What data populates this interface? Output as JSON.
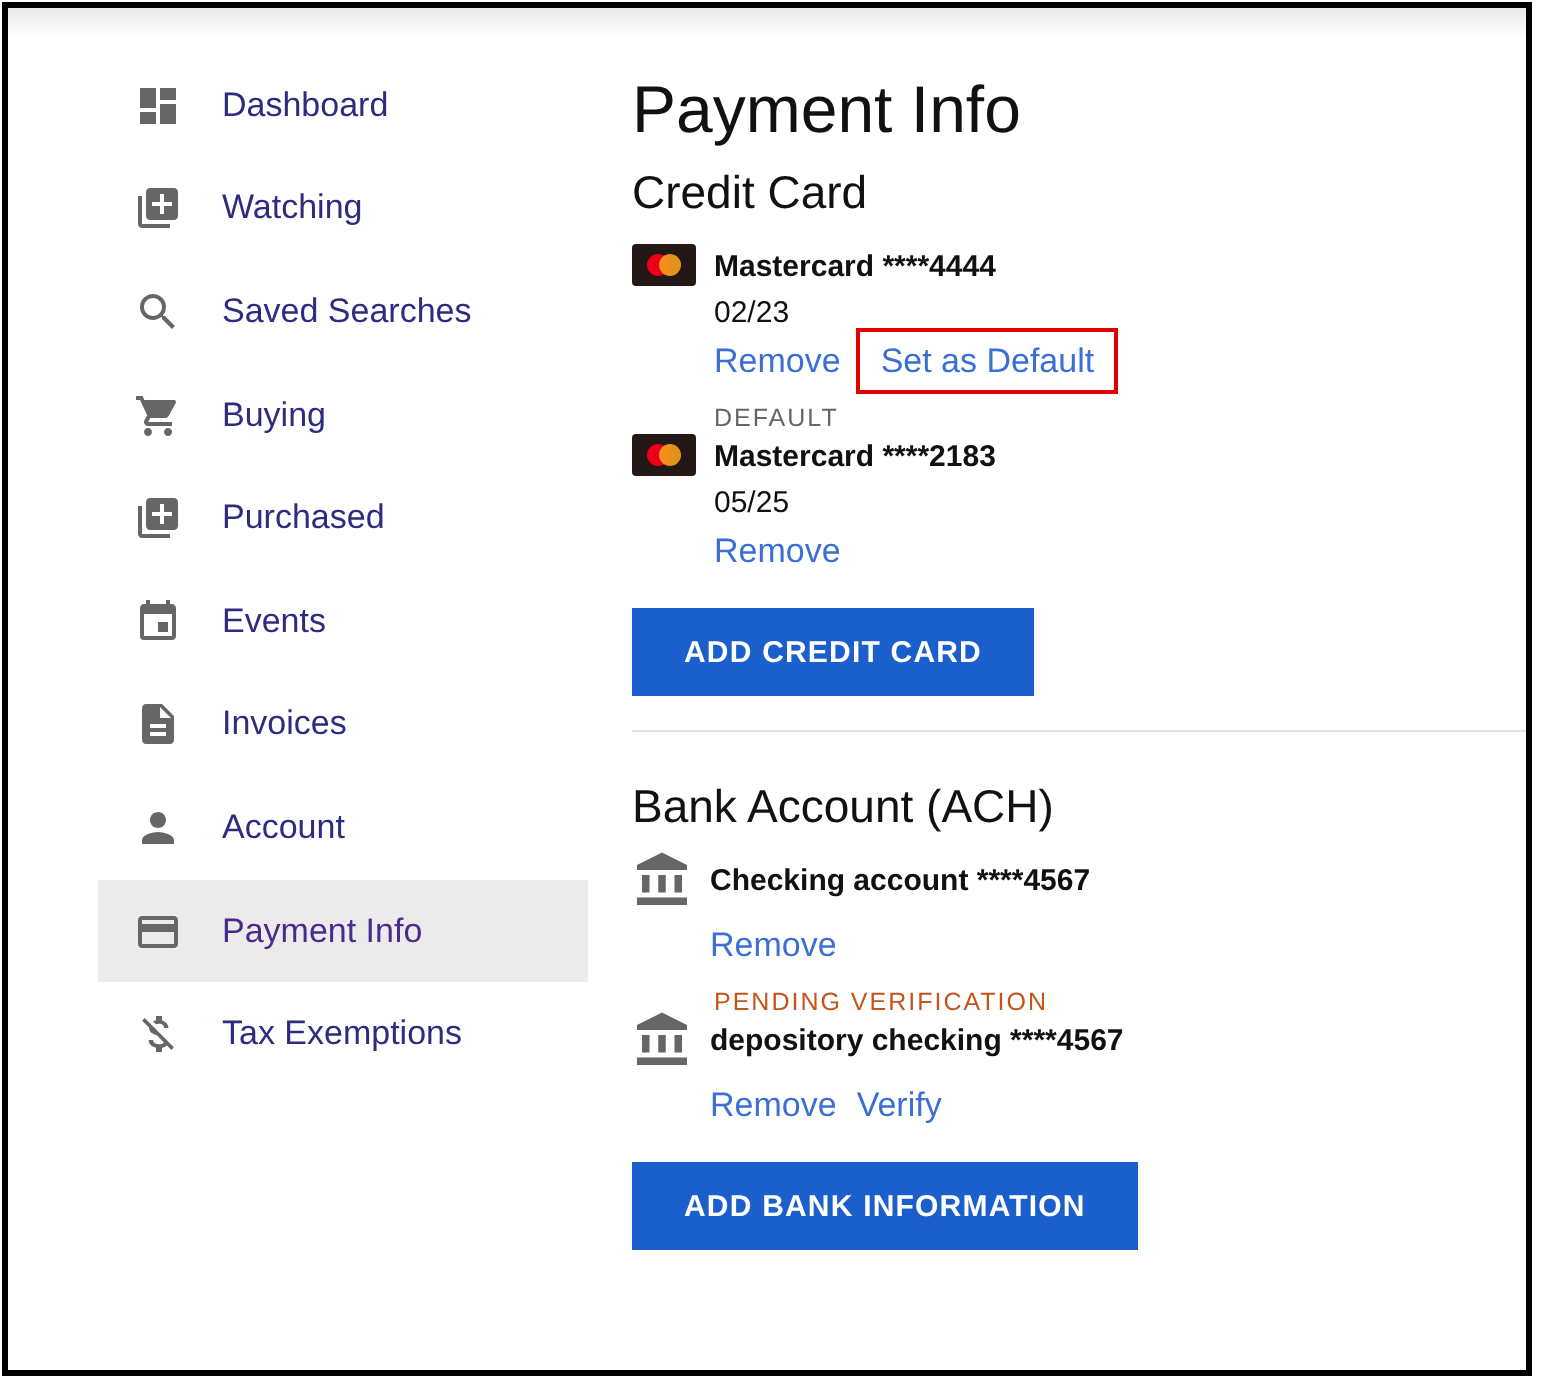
{
  "sidebar": {
    "items": [
      {
        "label": "Dashboard",
        "selected": false
      },
      {
        "label": "Watching",
        "selected": false
      },
      {
        "label": "Saved Searches",
        "selected": false
      },
      {
        "label": "Buying",
        "selected": false
      },
      {
        "label": "Purchased",
        "selected": false
      },
      {
        "label": "Events",
        "selected": false
      },
      {
        "label": "Invoices",
        "selected": false
      },
      {
        "label": "Account",
        "selected": false
      },
      {
        "label": "Payment Info",
        "selected": true
      },
      {
        "label": "Tax Exemptions",
        "selected": false
      }
    ]
  },
  "page_title": "Payment Info",
  "sections": [
    {
      "title": "Credit Card",
      "methods": [
        {
          "kind": "card",
          "name": "Mastercard ****4444",
          "expiry": "02/23",
          "actions": [
            {
              "label": "Remove",
              "highlighted": false
            },
            {
              "label": "Set as Default",
              "highlighted": true
            }
          ]
        },
        {
          "kind": "card",
          "status": {
            "kind": "default",
            "label": "DEFAULT"
          },
          "name": "Mastercard ****2183",
          "expiry": "05/25",
          "actions": [
            {
              "label": "Remove",
              "highlighted": false
            }
          ]
        }
      ],
      "button": "ADD CREDIT CARD"
    },
    {
      "title": "Bank Account (ACH)",
      "methods": [
        {
          "kind": "bank",
          "name": "Checking account ****4567",
          "actions": [
            {
              "label": "Remove",
              "highlighted": false
            }
          ]
        },
        {
          "kind": "bank",
          "status": {
            "kind": "pending",
            "label": "PENDING VERIFICATION"
          },
          "name": "depository checking ****4567",
          "actions": [
            {
              "label": "Remove",
              "highlighted": false
            },
            {
              "label": "Verify",
              "highlighted": false
            }
          ]
        }
      ],
      "button": "ADD BANK INFORMATION"
    }
  ]
}
